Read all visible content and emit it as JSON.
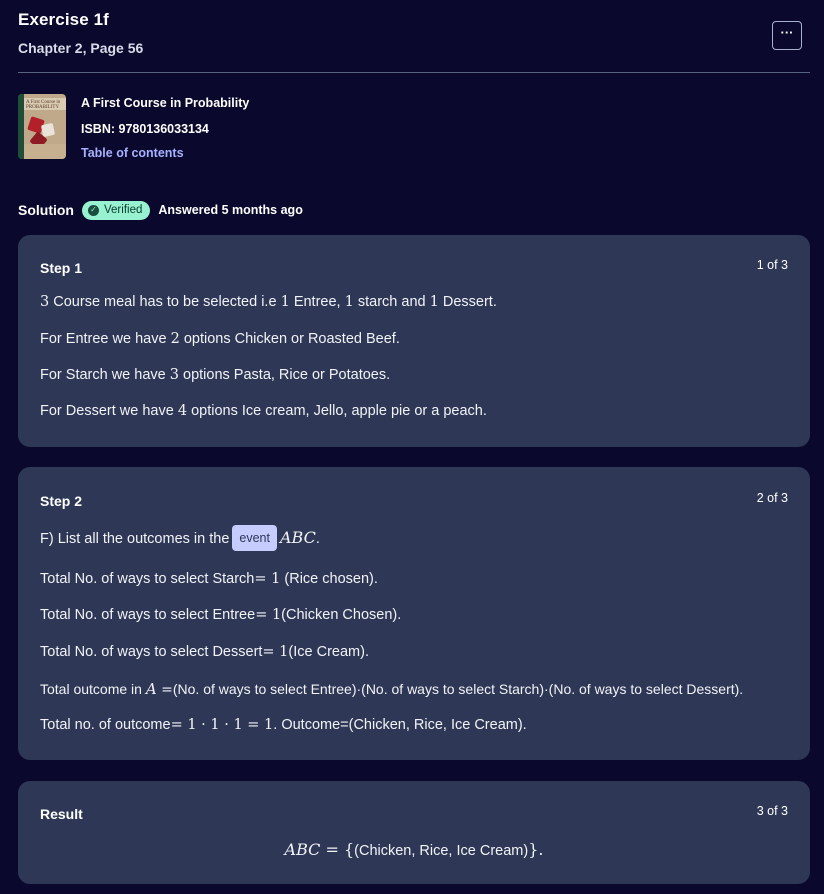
{
  "header": {
    "title": "Exercise 1f",
    "subtitle": "Chapter 2, Page 56",
    "more_label": "···"
  },
  "book": {
    "cover_text": "A First Course in PROBABILITY",
    "title": "A First Course in Probability",
    "isbn": "ISBN: 9780136033134",
    "toc_link": "Table of contents"
  },
  "solution": {
    "label": "Solution",
    "verified_badge": "Verified",
    "answered": "Answered 5 months ago"
  },
  "steps": [
    {
      "title": "Step 1",
      "count": "1 of 3",
      "lines": {
        "l1_n1": "3",
        "l1_t1": " Course meal has to be selected i.e ",
        "l1_n2": "1",
        "l1_t2": " Entree, ",
        "l1_n3": "1",
        "l1_t3": " starch and ",
        "l1_n4": "1",
        "l1_t4": " Dessert.",
        "l2_t1": "For Entree we have ",
        "l2_n1": "2",
        "l2_t2": " options Chicken or Roasted Beef.",
        "l3_t1": "For Starch we have ",
        "l3_n1": "3",
        "l3_t2": " options Pasta, Rice or Potatoes.",
        "l4_t1": "For Dessert we have ",
        "l4_n1": "4",
        "l4_t2": " options Ice cream, Jello, apple pie or a peach."
      }
    },
    {
      "title": "Step 2",
      "count": "2 of 3",
      "lines": {
        "l1_t1": "F) List all the outcomes in the",
        "l1_tag": "event",
        "l1_m": "ABC",
        "l1_t2": ".",
        "l2_t1": "Total No. of ways to select Starch",
        "l2_m": "= 1",
        "l2_t2": " (Rice chosen).",
        "l3_t1": "Total No. of ways to select Entree",
        "l3_m": "= 1",
        "l3_t2": "(Chicken Chosen).",
        "l4_t1": "Total No. of ways to select Dessert",
        "l4_m": "= 1",
        "l4_t2": "(Ice Cream).",
        "l5_t1": "Total outcome in ",
        "l5_mi": "A",
        "l5_m": " =",
        "l5_t2": "(No. of ways to select Entree)·(No. of ways to select Starch)·(No. of ways to select Dessert).",
        "l6_t1": "Total no. of outcome",
        "l6_m": "= 1 · 1 · 1 = 1",
        "l6_t2": ". Outcome=(Chicken, Rice, Ice Cream)."
      }
    },
    {
      "title": "Result",
      "count": "3 of 3",
      "lines": {
        "r_mi": "ABC",
        "r_m1": " = {",
        "r_t": "(Chicken, Rice, Ice Cream)",
        "r_m2": "}."
      }
    }
  ]
}
